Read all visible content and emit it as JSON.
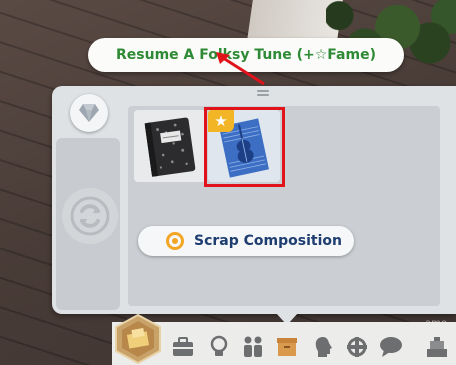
{
  "tooltip": {
    "text": "Resume A Folksy Tune (+☆Fame)"
  },
  "panel": {
    "scrap_button_label": "Scrap Composition",
    "selected_tile": "violin-sheet-music",
    "tiles": [
      {
        "name": "composition-notebook"
      },
      {
        "name": "violin-sheet-music",
        "badge": "★"
      }
    ]
  },
  "watermark": "ame",
  "icons": {
    "gem": "diamond-icon",
    "refresh": "cycle-icon",
    "career": "career-icon",
    "toolbar": [
      "briefcase-icon",
      "lightbulb-icon",
      "household-icon",
      "inventory-icon",
      "head-icon",
      "aspiration-icon",
      "social-icon",
      "build-buy-icon"
    ]
  },
  "colors": {
    "tooltip_text": "#2e8a34",
    "highlight": "#e0131a",
    "star": "#f2b526",
    "button_text": "#1e3d70"
  }
}
